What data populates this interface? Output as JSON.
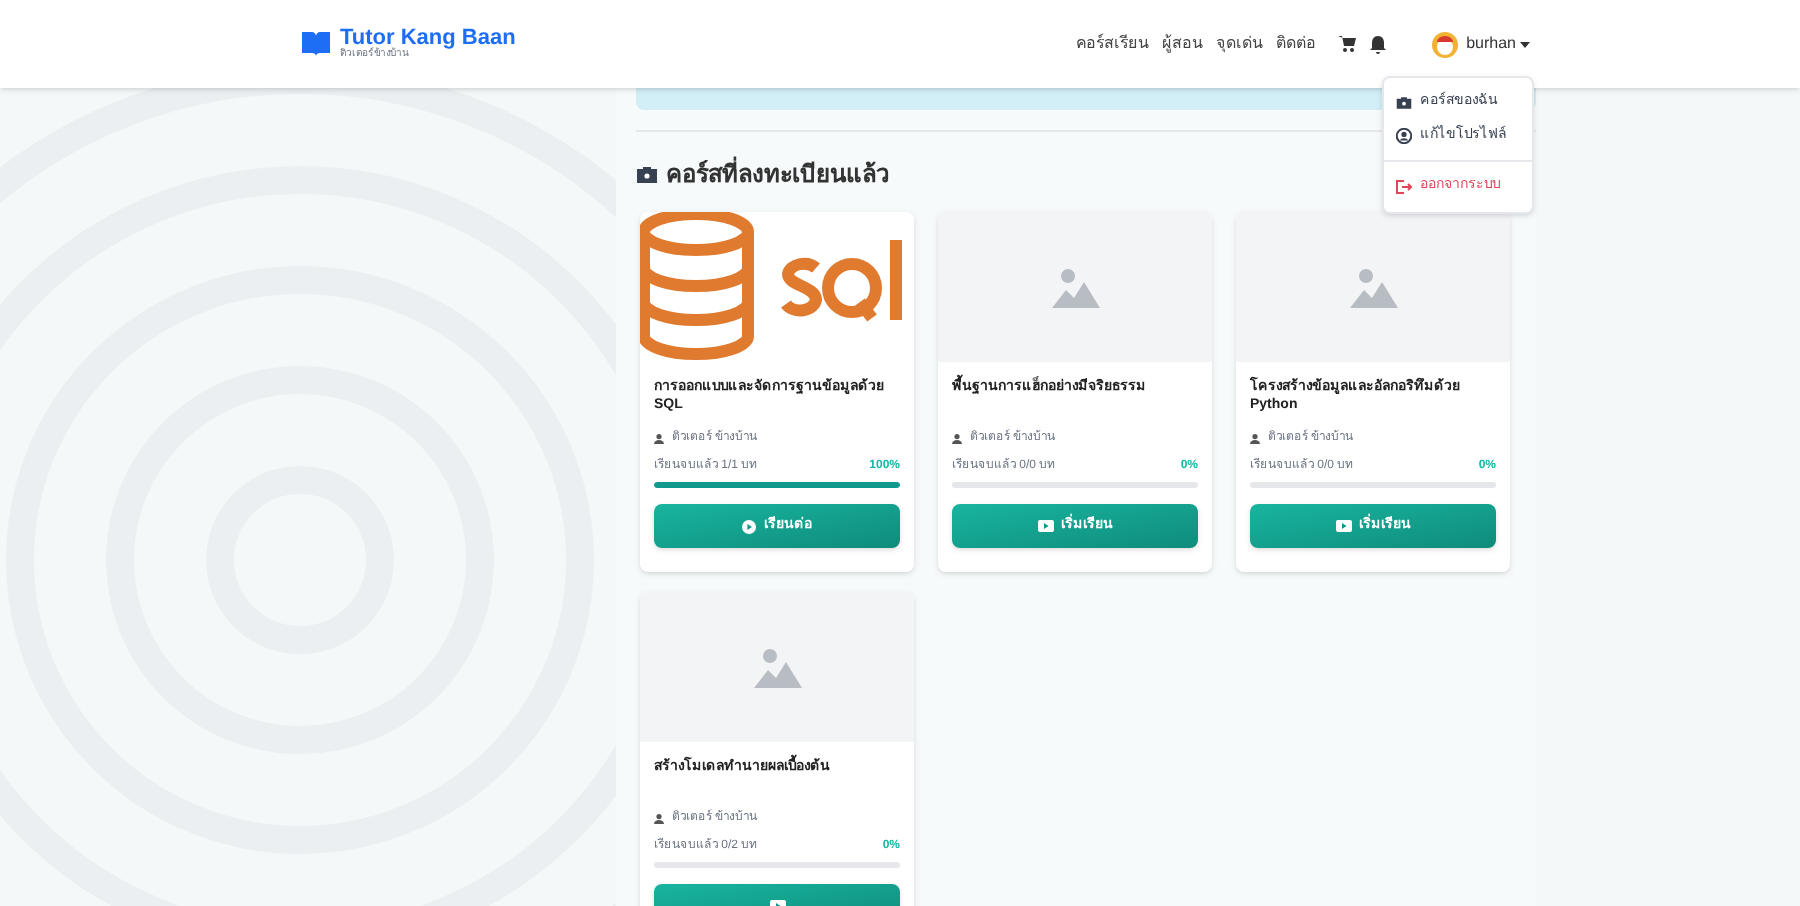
{
  "brand": {
    "name": "Tutor Kang Baan",
    "tagline": "ติวเตอร์ข้างบ้าน"
  },
  "nav": [
    "คอร์สเรียน",
    "ผู้สอน",
    "จุดเด่น",
    "ติดต่อ"
  ],
  "user": {
    "name": "burhan"
  },
  "user_menu": [
    {
      "label": "คอร์สของฉัน",
      "kind": "course"
    },
    {
      "label": "แก้ไขโปรไฟล์",
      "kind": "profile"
    },
    {
      "label": "ออกจากระบบ",
      "kind": "logout"
    }
  ],
  "section_title": "คอร์สที่ลงทะเบียนแล้ว",
  "courses": [
    {
      "thumbnail": {
        "kind": "sql"
      },
      "title": "การออกแบบและจัดการฐานข้อมูลด้วย SQL",
      "instructor": "ติวเตอร์ ข้างบ้าน",
      "progress_text": "เรียนจบแล้ว 1/1 บท",
      "percent": "100%",
      "level": 1,
      "button": {
        "label": "เรียนต่อ",
        "kind": "continue"
      }
    },
    {
      "thumbnail": {
        "kind": "placeholder"
      },
      "title": "พื้นฐานการแฮ็กอย่างมีจริยธรรม",
      "instructor": "ติวเตอร์ ข้างบ้าน",
      "progress_text": "เรียนจบแล้ว 0/0 บท",
      "percent": "0%",
      "level": 0,
      "button": {
        "label": "เริ่มเรียน",
        "kind": "start"
      }
    },
    {
      "thumbnail": {
        "kind": "placeholder"
      },
      "title": "โครงสร้างข้อมูลและอัลกอริทึมด้วย Python",
      "instructor": "ติวเตอร์ ข้างบ้าน",
      "progress_text": "เรียนจบแล้ว 0/0 บท",
      "percent": "0%",
      "level": 0,
      "button": {
        "label": "เริ่มเรียน",
        "kind": "start"
      }
    },
    {
      "thumbnail": {
        "kind": "placeholder"
      },
      "title": "สร้างโมเดลทำนายผลเบื้องต้น",
      "instructor": "ติวเตอร์ ข้างบ้าน",
      "progress_text": "เรียนจบแล้ว 0/2 บท",
      "percent": "0%",
      "level": 0,
      "button": {
        "kind": "start"
      }
    }
  ]
}
